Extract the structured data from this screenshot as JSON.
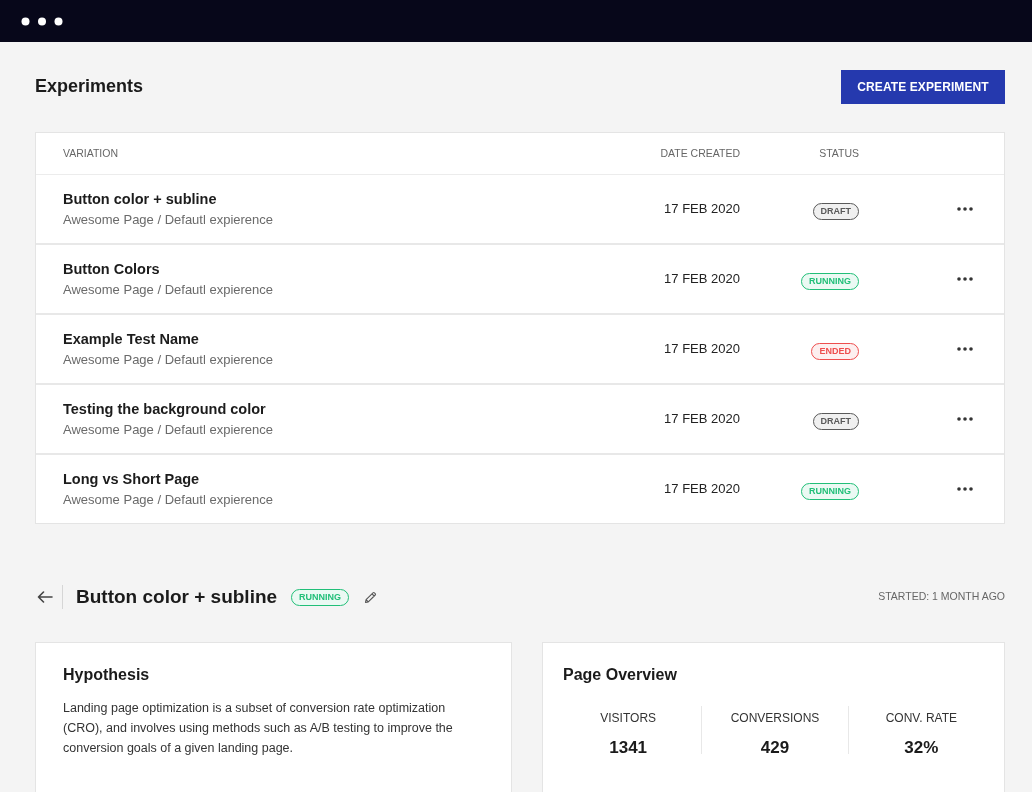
{
  "header": {
    "title": "Experiments",
    "action": "CREATE EXPERIMENT"
  },
  "table": {
    "columns": [
      "VARIATION",
      "DATE CREATED",
      "STATUS"
    ],
    "rows": [
      {
        "name": "Button color + subline",
        "path": "Awesome Page / Defautl expierence",
        "date": "17 FEB 2020",
        "status": {
          "label": "DRAFT",
          "color": "#5a5a5a"
        }
      },
      {
        "name": "Button Colors",
        "path": "Awesome Page / Defautl expierence",
        "date": "17 FEB 2020",
        "status": {
          "label": "RUNNING",
          "color": "#21bf78"
        }
      },
      {
        "name": "Example Test Name",
        "path": "Awesome Page / Defautl expierence",
        "date": "17 FEB 2020",
        "status": {
          "label": "ENDED",
          "color": "#ee4d4d"
        }
      },
      {
        "name": "Testing the background color",
        "path": "Awesome Page / Defautl expierence",
        "date": "17 FEB 2020",
        "status": {
          "label": "DRAFT",
          "color": "#5a5a5a"
        }
      },
      {
        "name": "Long vs Short Page",
        "path": "Awesome Page / Defautl expierence",
        "date": "17 FEB 2020",
        "status": {
          "label": "RUNNING",
          "color": "#21bf78"
        }
      }
    ]
  },
  "detail": {
    "title": "Button color + subline",
    "status": {
      "label": "RUNNING",
      "color": "#21bf78"
    },
    "started": "STARTED: 1 MONTH AGO",
    "hypothesis": {
      "title": "Hypothesis",
      "text": "Landing page optimization is a subset of conversion rate optimization (CRO), and involves using methods such as A/B testing to improve the conversion goals of a given landing page."
    },
    "overview": {
      "title": "Page Overview",
      "stats": [
        {
          "label": "VISITORS",
          "value": "1341"
        },
        {
          "label": "CONVERSIONS",
          "value": "429"
        },
        {
          "label": "CONV. RATE",
          "value": "32%"
        }
      ]
    }
  }
}
